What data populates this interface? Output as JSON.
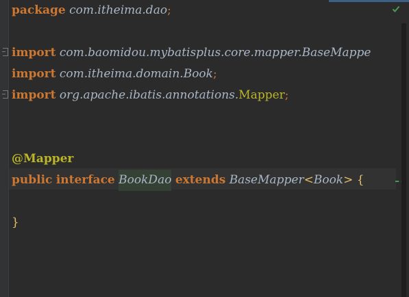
{
  "code": {
    "line1": {
      "kw": "package",
      "name": "com.itheima.dao",
      "semi": ";"
    },
    "import1": {
      "kw": "import",
      "name": "com.baomidou.mybatisplus.core.mapper.BaseMappe"
    },
    "import2": {
      "kw": "import",
      "name": "com.itheima.domain.Book",
      "semi": ";"
    },
    "import3": {
      "kw": "import",
      "name": "org.apache.ibatis.annotations.",
      "cls": "Mapper",
      "semi": ";"
    },
    "annotation": "@Mapper",
    "decl": {
      "kw_public": "public",
      "kw_interface": "interface",
      "name": "BookDao",
      "kw_extends": "extends",
      "base": "BaseMapper",
      "lt": "<",
      "generic": "Book",
      "gt": ">",
      "open": "{"
    },
    "close": "}"
  },
  "status": {
    "icon": "check-icon",
    "color": "#499c54"
  }
}
